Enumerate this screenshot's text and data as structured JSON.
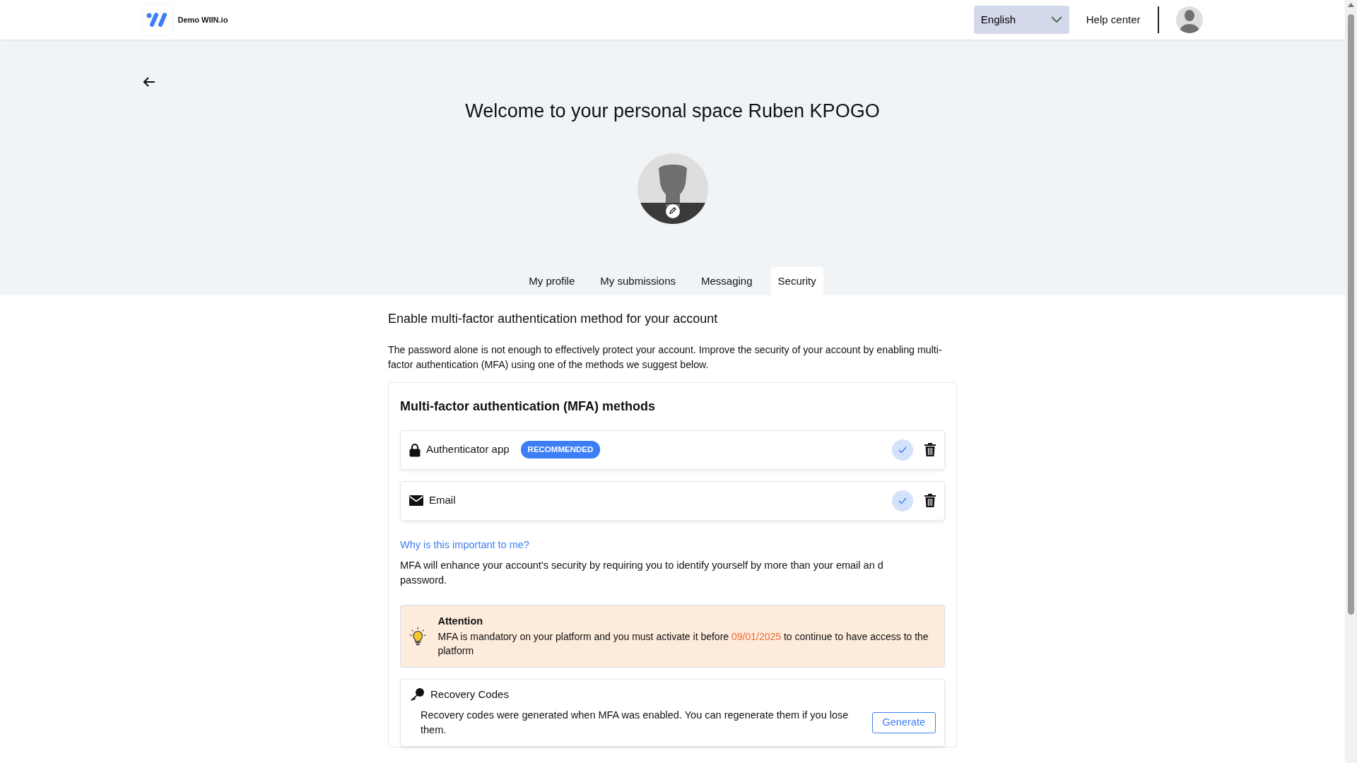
{
  "header": {
    "brand": "Demo WIIN.io",
    "language": "English",
    "help": "Help center"
  },
  "title": "Welcome to your personal space Ruben KPOGO",
  "tabs": [
    {
      "label": "My profile",
      "selected": false
    },
    {
      "label": "My submissions",
      "selected": false
    },
    {
      "label": "Messaging",
      "selected": false
    },
    {
      "label": "Security",
      "selected": true
    }
  ],
  "section": {
    "heading": "Enable multi-factor authentication method for your account",
    "intro": "The password alone is not enough to effectively protect your account. Improve the security of your account by enabling multi-factor authentication (MFA) using one of the methods we suggest below."
  },
  "mfa": {
    "title": "Multi-factor authentication (MFA) methods",
    "methods": [
      {
        "kind": "app",
        "label": "Authenticator app",
        "badge": "RECOMMENDED",
        "enabled": true
      },
      {
        "kind": "email",
        "label": "Email",
        "enabled": true
      }
    ],
    "why_link": "Why is this important to me?",
    "why_text": "MFA will enhance your account's security by requiring you to identify yourself by more than your email an d password.",
    "alert": {
      "title": "Attention",
      "text_before": "MFA is mandatory on your platform and you must activate it before",
      "date": "09/01/2025",
      "text_after": "to continue to have access to the platform"
    },
    "recovery": {
      "title": "Recovery Codes",
      "text": "Recovery codes were generated when MFA was enabled. You can regenerate them if you lose them.",
      "button": "Generate"
    }
  }
}
